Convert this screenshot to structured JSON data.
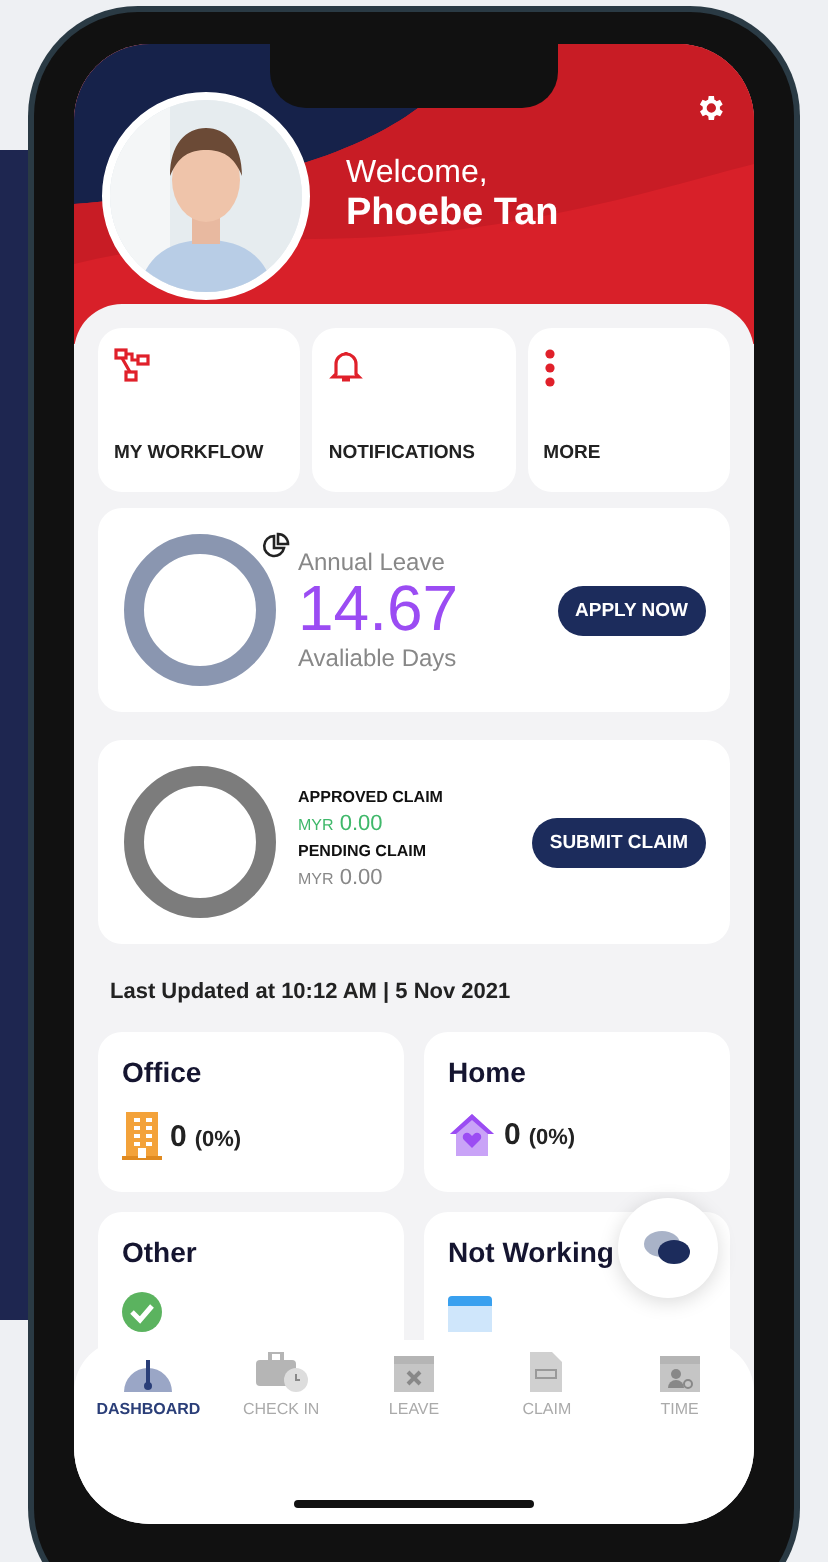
{
  "header": {
    "greeting": "Welcome,",
    "name": "Phoebe Tan"
  },
  "shortcuts": [
    {
      "label": "MY WORKFLOW",
      "kind": "workflow"
    },
    {
      "label": "NOTIFICATIONS",
      "kind": "bell"
    },
    {
      "label": "MORE",
      "kind": "more"
    }
  ],
  "leave": {
    "title": "Annual Leave",
    "value": "14.67",
    "caption": "Avaliable Days",
    "button": "APPLY NOW"
  },
  "claim": {
    "approved_label": "APPROVED CLAIM",
    "approved_currency": "MYR",
    "approved_value": "0.00",
    "pending_label": "PENDING CLAIM",
    "pending_currency": "MYR",
    "pending_value": "0.00",
    "button": "SUBMIT CLAIM"
  },
  "last_updated": "Last Updated at 10:12 AM | 5 Nov 2021",
  "locations": [
    {
      "title": "Office",
      "kind": "office",
      "count": "0",
      "percent": "(0%)"
    },
    {
      "title": "Home",
      "kind": "home",
      "count": "0",
      "percent": "(0%)"
    },
    {
      "title": "Other",
      "kind": "other"
    },
    {
      "title": "Not Working",
      "kind": "not_working"
    }
  ],
  "nav": [
    {
      "label": "DASHBOARD",
      "kind": "dashboard",
      "selected": true
    },
    {
      "label": "CHECK IN",
      "kind": "checkin",
      "selected": false
    },
    {
      "label": "LEAVE",
      "kind": "leave",
      "selected": false
    },
    {
      "label": "CLAIM",
      "kind": "claim",
      "selected": false
    },
    {
      "label": "TIME",
      "kind": "time",
      "selected": false
    }
  ]
}
